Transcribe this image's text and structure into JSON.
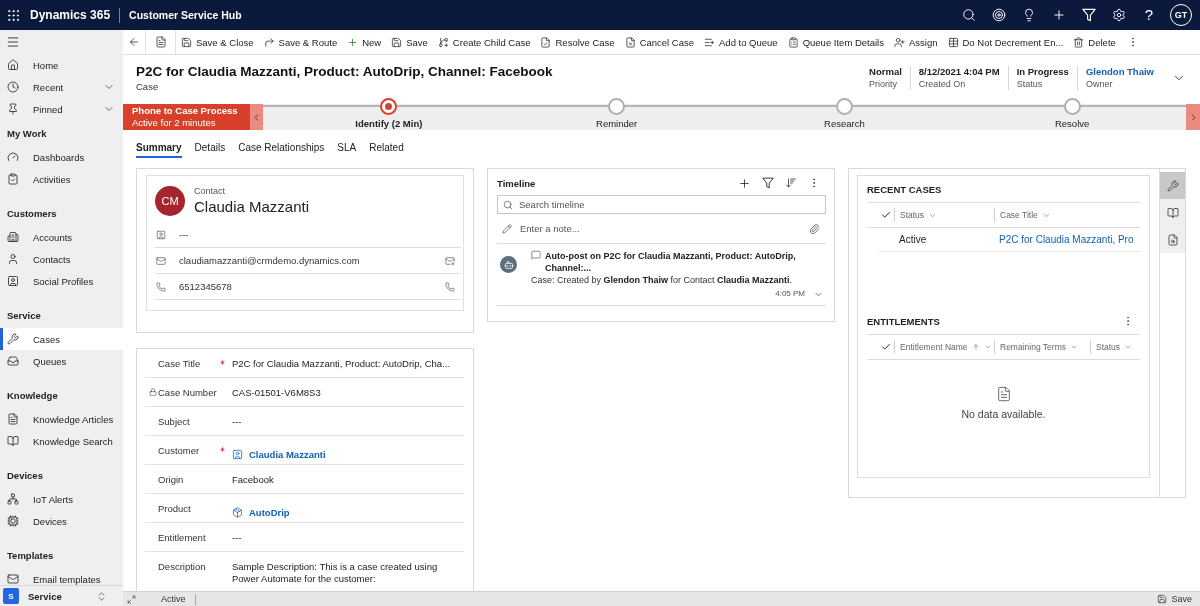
{
  "app_bar": {
    "brand": "Dynamics 365",
    "app_name": "Customer Service Hub",
    "help": "?",
    "user_initials": "GT"
  },
  "sidebar": {
    "top_items": [
      {
        "label": "Home",
        "selected": false
      },
      {
        "label": "Recent",
        "selected": false,
        "expanded": false
      },
      {
        "label": "Pinned",
        "selected": false,
        "expanded": false
      }
    ],
    "groups": [
      {
        "title": "My Work",
        "items": [
          {
            "label": "Dashboards",
            "selected": false
          },
          {
            "label": "Activities",
            "selected": false
          }
        ]
      },
      {
        "title": "Customers",
        "items": [
          {
            "label": "Accounts",
            "selected": false
          },
          {
            "label": "Contacts",
            "selected": false
          },
          {
            "label": "Social Profiles",
            "selected": false
          }
        ]
      },
      {
        "title": "Service",
        "items": [
          {
            "label": "Cases",
            "selected": true
          },
          {
            "label": "Queues",
            "selected": false
          }
        ]
      },
      {
        "title": "Knowledge",
        "items": [
          {
            "label": "Knowledge Articles",
            "selected": false
          },
          {
            "label": "Knowledge Search",
            "selected": false
          }
        ]
      },
      {
        "title": "Devices",
        "items": [
          {
            "label": "IoT Alerts",
            "selected": false
          },
          {
            "label": "Devices",
            "selected": false
          }
        ]
      },
      {
        "title": "Templates",
        "items": [
          {
            "label": "Email templates",
            "selected": false
          }
        ]
      }
    ],
    "area_switcher": {
      "badge": "S",
      "label": "Service"
    }
  },
  "command_bar": {
    "items": [
      "Save & Close",
      "Save & Route",
      "New",
      "Save",
      "Create Child Case",
      "Resolve Case",
      "Cancel Case",
      "Add to Queue",
      "Queue Item Details",
      "Assign",
      "Do Not Decrement En...",
      "Delete"
    ]
  },
  "header": {
    "title": "P2C for Claudia Mazzanti, Product: AutoDrip, Channel: Facebook",
    "entity": "Case",
    "fields": [
      {
        "value": "Normal",
        "label": "Priority",
        "kind": "text"
      },
      {
        "value": "8/12/2021 4:04 PM",
        "label": "Created On",
        "kind": "text"
      },
      {
        "value": "In Progress",
        "label": "Status",
        "kind": "text"
      },
      {
        "value": "Glendon Thaiw",
        "label": "Owner",
        "kind": "link"
      }
    ],
    "expanded": false
  },
  "process_bar": {
    "name": "Phone to Case Process",
    "duration": "Active for 2 minutes",
    "stages": [
      {
        "label": "Identify",
        "duration": "(2 Min)",
        "selected": true
      },
      {
        "label": "Reminder",
        "selected": false
      },
      {
        "label": "Research",
        "selected": false
      },
      {
        "label": "Resolve",
        "selected": false
      }
    ]
  },
  "tabs": [
    {
      "label": "Summary",
      "selected": true
    },
    {
      "label": "Details",
      "selected": false
    },
    {
      "label": "Case Relationships",
      "selected": false
    },
    {
      "label": "SLA",
      "selected": false
    },
    {
      "label": "Related",
      "selected": false
    }
  ],
  "contact_card": {
    "entity_label": "Contact",
    "name": "Claudia Mazzanti",
    "initials": "CM",
    "rows": [
      {
        "kind": "profile",
        "value": "---"
      },
      {
        "kind": "email",
        "value": "claudiamazzanti@crmdemo.dynamics.com"
      },
      {
        "kind": "phone",
        "value": "6512345678"
      }
    ]
  },
  "case_form": {
    "fields": [
      {
        "label": "Case Title",
        "required": true,
        "locked": false,
        "kind": "text",
        "value": "P2C for Claudia Mazzanti, Product: AutoDrip, Cha..."
      },
      {
        "label": "Case Number",
        "required": false,
        "locked": true,
        "kind": "text",
        "value": "CAS-01501-V6M8S3"
      },
      {
        "label": "Subject",
        "required": false,
        "locked": false,
        "kind": "text",
        "value": "---"
      },
      {
        "label": "Customer",
        "required": true,
        "locked": false,
        "kind": "contact_link",
        "value": "Claudia Mazzanti"
      },
      {
        "label": "Origin",
        "required": false,
        "locked": false,
        "kind": "text",
        "value": "Facebook"
      },
      {
        "label": "Product",
        "required": false,
        "locked": false,
        "kind": "product_link",
        "value": "AutoDrip"
      },
      {
        "label": "Entitlement",
        "required": false,
        "locked": false,
        "kind": "text",
        "value": "---"
      },
      {
        "label": "Description",
        "required": false,
        "locked": false,
        "kind": "multiline",
        "value": "Sample Description: This is a case created using Power Automate for the customer:"
      }
    ]
  },
  "timeline": {
    "title": "Timeline",
    "search_placeholder": "Search timeline",
    "note_placeholder": "Enter a note...",
    "entries": [
      {
        "title": "Auto-post on P2C for Claudia Mazzanti, Product: AutoDrip, Channel:...",
        "text": "Case: Created by **Glendon Thaiw** for Contact **Claudia Mazzanti**.",
        "time": "4:05 PM",
        "expanded": false
      }
    ]
  },
  "recent_cases": {
    "title": "RECENT CASES",
    "columns": [
      {
        "label": "Status"
      },
      {
        "label": "Case Title"
      }
    ],
    "rows": [
      {
        "status": "Active",
        "case_title": "P2C for Claudia Mazzanti, Pro"
      }
    ]
  },
  "entitlements": {
    "title": "ENTITLEMENTS",
    "columns": [
      {
        "label": "Entitlement Name",
        "sorted": true
      },
      {
        "label": "Remaining Terms",
        "sorted": false
      },
      {
        "label": "Status",
        "sorted": false
      }
    ],
    "empty_text": "No data available."
  },
  "side_rail": [
    {
      "selected": true
    },
    {
      "selected": false
    },
    {
      "selected": false
    }
  ],
  "status_bar": {
    "status": "Active",
    "save_label": "Save"
  }
}
